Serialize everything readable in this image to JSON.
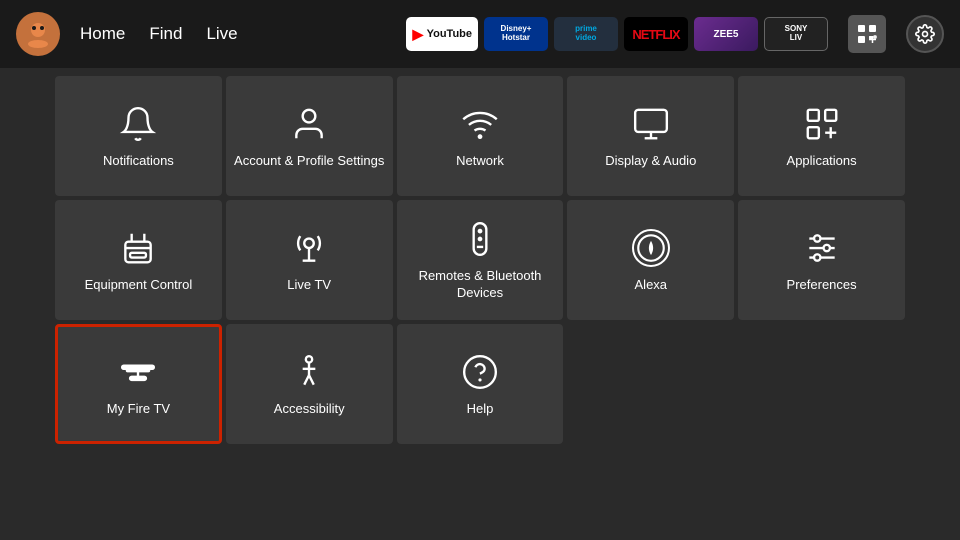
{
  "nav": {
    "links": [
      "Home",
      "Find",
      "Live"
    ],
    "apps": [
      {
        "id": "youtube",
        "label": "▶ YouTube",
        "class": "app-youtube"
      },
      {
        "id": "disney",
        "label": "Disney+ Hotstar",
        "class": "app-disney"
      },
      {
        "id": "prime",
        "label": "prime video",
        "class": "app-prime"
      },
      {
        "id": "netflix",
        "label": "NETFLIX",
        "class": "app-netflix"
      },
      {
        "id": "zee5",
        "label": "ZEE5",
        "class": "app-zee5"
      },
      {
        "id": "sony",
        "label": "SONY LIV",
        "class": "app-sony"
      }
    ]
  },
  "tiles": [
    {
      "id": "notifications",
      "label": "Notifications",
      "icon": "bell",
      "selected": false
    },
    {
      "id": "account",
      "label": "Account & Profile Settings",
      "icon": "person",
      "selected": false
    },
    {
      "id": "network",
      "label": "Network",
      "icon": "wifi",
      "selected": false
    },
    {
      "id": "display-audio",
      "label": "Display & Audio",
      "icon": "display",
      "selected": false
    },
    {
      "id": "applications",
      "label": "Applications",
      "icon": "apps",
      "selected": false
    },
    {
      "id": "equipment-control",
      "label": "Equipment Control",
      "icon": "tv-remote",
      "selected": false
    },
    {
      "id": "live-tv",
      "label": "Live TV",
      "icon": "antenna",
      "selected": false
    },
    {
      "id": "remotes-bluetooth",
      "label": "Remotes & Bluetooth Devices",
      "icon": "remote",
      "selected": false
    },
    {
      "id": "alexa",
      "label": "Alexa",
      "icon": "alexa",
      "selected": false
    },
    {
      "id": "preferences",
      "label": "Preferences",
      "icon": "sliders",
      "selected": false
    },
    {
      "id": "my-fire-tv",
      "label": "My Fire TV",
      "icon": "fire-tv",
      "selected": true
    },
    {
      "id": "accessibility",
      "label": "Accessibility",
      "icon": "accessibility",
      "selected": false
    },
    {
      "id": "help",
      "label": "Help",
      "icon": "help",
      "selected": false
    }
  ]
}
